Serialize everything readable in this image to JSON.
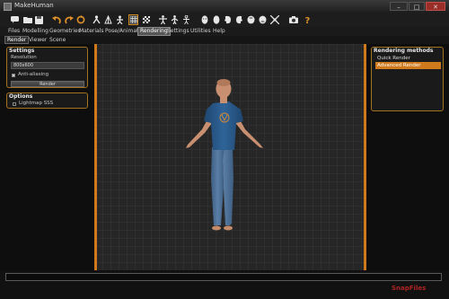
{
  "window": {
    "title": "MakeHuman",
    "controls": {
      "minimize": "–",
      "maximize": "□",
      "close": "✕"
    }
  },
  "toolbar": {
    "tools": [
      {
        "icon": "speech-bubble-icon"
      },
      {
        "icon": "folder-icon"
      },
      {
        "icon": "save-icon"
      },
      {
        "icon": "undo-icon"
      },
      {
        "icon": "redo-icon"
      },
      {
        "icon": "reset-icon"
      },
      {
        "icon": "smooth-icon"
      },
      {
        "icon": "wireframe-icon"
      },
      {
        "icon": "background-icon"
      },
      {
        "icon": "grid-icon",
        "active": true
      },
      {
        "icon": "checker-icon"
      },
      {
        "icon": "pose-icon"
      },
      {
        "icon": "figure-icon"
      },
      {
        "icon": "skeleton-icon"
      },
      {
        "icon": "front-view-icon"
      },
      {
        "icon": "back-view-icon"
      },
      {
        "icon": "left-view-icon"
      },
      {
        "icon": "right-view-icon"
      },
      {
        "icon": "top-view-icon"
      },
      {
        "icon": "bottom-view-icon"
      },
      {
        "icon": "reset-camera-icon"
      },
      {
        "icon": "screenshot-icon"
      },
      {
        "icon": "help-icon"
      }
    ]
  },
  "menu": {
    "tabs": [
      "Files",
      "Modelling",
      "Geometries",
      "Materials",
      "Pose/Animate",
      "Rendering",
      "Settings",
      "Utilities",
      "Help"
    ],
    "active": "Rendering"
  },
  "subtabs": {
    "tabs": [
      "Render",
      "Viewer",
      "Scene"
    ],
    "active": "Render"
  },
  "settings": {
    "title": "Settings",
    "resolution_label": "Resolution",
    "resolution_value": "800x600",
    "antialias_label": "Anti-aliasing",
    "antialias_checked": true,
    "render_button": "Render"
  },
  "options": {
    "title": "Options",
    "lightmap_label": "Lightmap SSS",
    "lightmap_checked": false
  },
  "rendering_methods": {
    "title": "Rendering methods",
    "items": [
      "Quick Render",
      "Advanced Render"
    ],
    "selected": "Advanced Render"
  },
  "watermark": "SnapFiles",
  "colors": {
    "accent": "#d07a1e",
    "viewport_bg": "#262626",
    "grid_line": "#3a3a3a",
    "shirt": "#2a5a8c",
    "jeans": "#4b6c91",
    "skin": "#c89070"
  }
}
